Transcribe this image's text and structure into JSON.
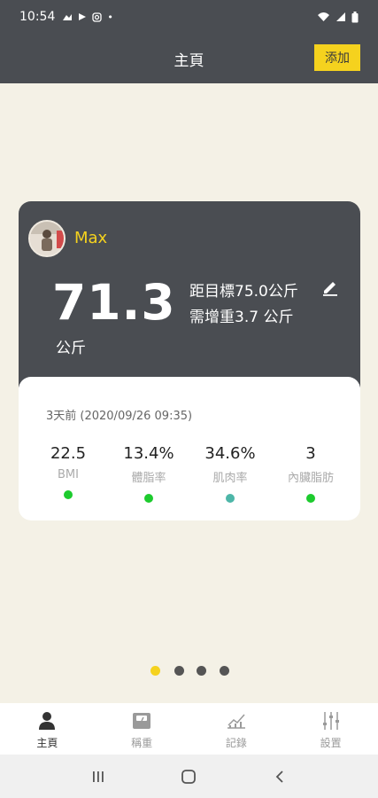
{
  "status": {
    "time": "10:54",
    "dot": "•"
  },
  "appbar": {
    "title": "主頁",
    "add_label": "添加"
  },
  "profile": {
    "name": "Max",
    "weight": "71.3",
    "unit": "公斤",
    "goal_text": "距目標75.0公斤",
    "gain_text": "需增重3.7 公斤"
  },
  "measurement": {
    "timestamp": "3天前 (2020/09/26 09:35)",
    "metrics": [
      {
        "value": "22.5",
        "label": "BMI",
        "status_color": "#1DCB2E"
      },
      {
        "value": "13.4%",
        "label": "體脂率",
        "status_color": "#1DCB2E"
      },
      {
        "value": "34.6%",
        "label": "肌肉率",
        "status_color": "#4DB6A8"
      },
      {
        "value": "3",
        "label": "內臟脂肪",
        "status_color": "#1DCB2E"
      }
    ]
  },
  "pager": {
    "count": 4,
    "active": 0
  },
  "nav": {
    "items": [
      {
        "label": "主頁",
        "icon": "person-icon",
        "active": true
      },
      {
        "label": "稱重",
        "icon": "scale-icon",
        "active": false
      },
      {
        "label": "記錄",
        "icon": "chart-icon",
        "active": false
      },
      {
        "label": "設置",
        "icon": "sliders-icon",
        "active": false
      }
    ]
  },
  "colors": {
    "accent": "#F5D21E",
    "header": "#4A4D52",
    "background": "#F4F1E6"
  }
}
